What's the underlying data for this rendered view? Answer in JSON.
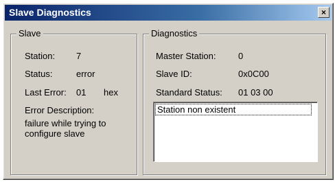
{
  "window": {
    "title": "Slave Diagnostics",
    "close_label": "×"
  },
  "slave": {
    "group_label": "Slave",
    "station_label": "Station:",
    "station_value": "7",
    "status_label": "Status:",
    "status_value": "error",
    "last_error_label": "Last Error:",
    "last_error_value": "01",
    "last_error_unit": "hex",
    "error_description_label": "Error Description:",
    "error_description_value": "failure while trying to configure slave"
  },
  "diagnostics": {
    "group_label": "Diagnostics",
    "master_station_label": "Master Station:",
    "master_station_value": "0",
    "slave_id_label": "Slave ID:",
    "slave_id_value": "0x0C00",
    "standard_status_label": "Standard Status:",
    "standard_status_value": "01 03 00",
    "list_items": [
      "Station non existent"
    ]
  }
}
